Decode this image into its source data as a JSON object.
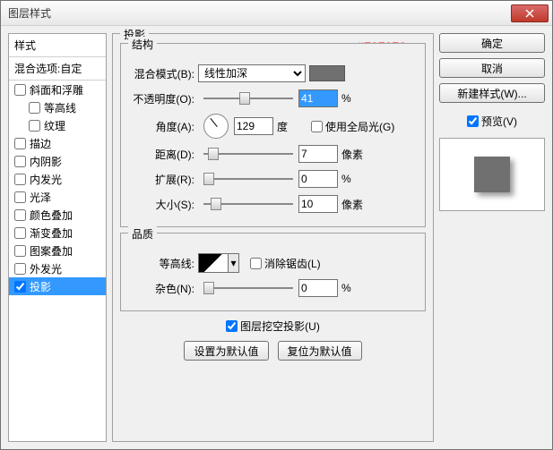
{
  "window": {
    "title": "图层样式"
  },
  "annotation": "#707070",
  "left": {
    "header": "样式",
    "blend_header": "混合选项:自定",
    "items": [
      {
        "label": "斜面和浮雕",
        "checked": false,
        "indent": false
      },
      {
        "label": "等高线",
        "checked": false,
        "indent": true
      },
      {
        "label": "纹理",
        "checked": false,
        "indent": true
      },
      {
        "label": "描边",
        "checked": false,
        "indent": false
      },
      {
        "label": "内阴影",
        "checked": false,
        "indent": false
      },
      {
        "label": "内发光",
        "checked": false,
        "indent": false
      },
      {
        "label": "光泽",
        "checked": false,
        "indent": false
      },
      {
        "label": "颜色叠加",
        "checked": false,
        "indent": false
      },
      {
        "label": "渐变叠加",
        "checked": false,
        "indent": false
      },
      {
        "label": "图案叠加",
        "checked": false,
        "indent": false
      },
      {
        "label": "外发光",
        "checked": false,
        "indent": false
      },
      {
        "label": "投影",
        "checked": true,
        "indent": false,
        "selected": true
      }
    ]
  },
  "panel": {
    "outer": "投影",
    "struct": "结构",
    "mode_label": "混合模式(B):",
    "mode_value": "线性加深",
    "opacity_label": "不透明度(O):",
    "opacity_value": "41",
    "opacity_unit": "%",
    "angle_label": "角度(A):",
    "angle_value": "129",
    "angle_unit": "度",
    "global_light": "使用全局光(G)",
    "distance_label": "距离(D):",
    "distance_value": "7",
    "distance_unit": "像素",
    "spread_label": "扩展(R):",
    "spread_value": "0",
    "spread_unit": "%",
    "size_label": "大小(S):",
    "size_value": "10",
    "size_unit": "像素",
    "quality": "品质",
    "contour_label": "等高线:",
    "antialias": "消除锯齿(L)",
    "noise_label": "杂色(N):",
    "noise_value": "0",
    "noise_unit": "%",
    "knockout": "图层挖空投影(U)",
    "btn_default": "设置为默认值",
    "btn_reset": "复位为默认值"
  },
  "right": {
    "ok": "确定",
    "cancel": "取消",
    "newstyle": "新建样式(W)...",
    "preview": "预览(V)"
  }
}
